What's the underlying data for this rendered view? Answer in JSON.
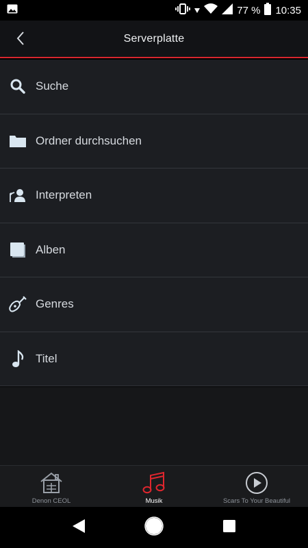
{
  "status_bar": {
    "battery": "77 %",
    "time": "10:35"
  },
  "header": {
    "title": "Serverplatte"
  },
  "menu": {
    "items": [
      {
        "label": "Suche",
        "icon": "search-icon"
      },
      {
        "label": "Ordner durchsuchen",
        "icon": "folder-icon"
      },
      {
        "label": "Interpreten",
        "icon": "artist-icon"
      },
      {
        "label": "Alben",
        "icon": "album-icon"
      },
      {
        "label": "Genres",
        "icon": "guitar-icon"
      },
      {
        "label": "Titel",
        "icon": "music-note-icon"
      }
    ]
  },
  "tabs": [
    {
      "label": "Denon CEOL",
      "icon": "house-icon",
      "active": false
    },
    {
      "label": "Musik",
      "icon": "music-notes-icon",
      "active": true
    },
    {
      "label": "Scars To Your Beautiful",
      "icon": "play-circle-icon",
      "active": false
    }
  ],
  "colors": {
    "accent": "#d8262e",
    "background": "#1c1e22",
    "icon": "#d9e6f0"
  }
}
